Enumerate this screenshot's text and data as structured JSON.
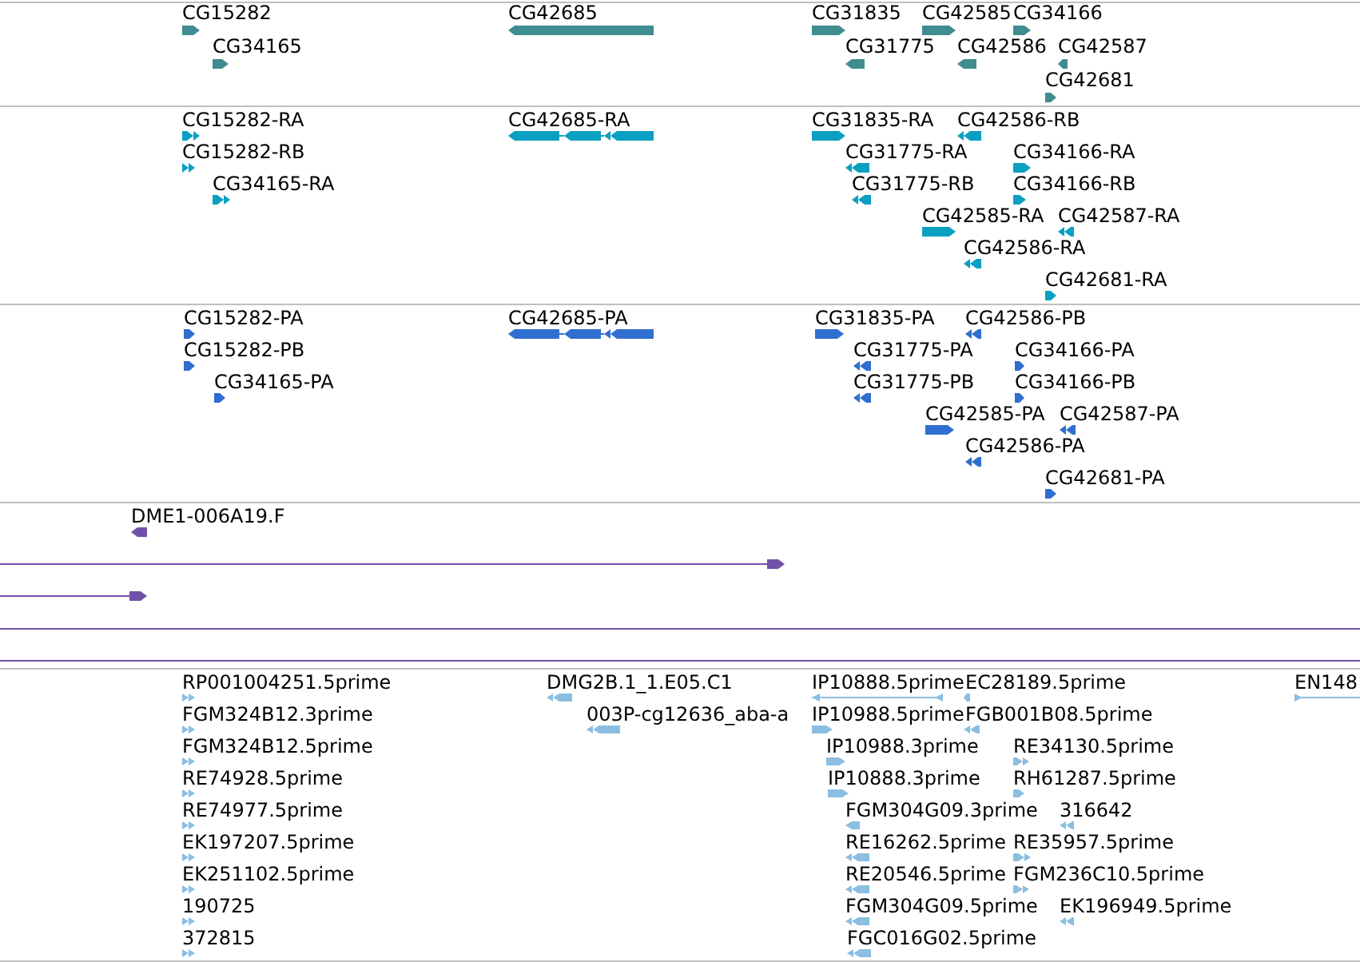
{
  "tracks": [
    {
      "color": "#3f8c91",
      "features": [
        {
          "label": "CG15282",
          "reverse": false
        },
        {
          "label": "CG42685",
          "reverse": true
        },
        {
          "label": "CG31835",
          "reverse": false
        },
        {
          "label": "CG42585",
          "reverse": false
        },
        {
          "label": "CG34166",
          "reverse": false
        },
        {
          "label": "CG34165",
          "reverse": false
        },
        {
          "label": "CG31775",
          "reverse": true
        },
        {
          "label": "CG42586",
          "reverse": true
        },
        {
          "label": "CG42587",
          "reverse": true
        },
        {
          "label": "CG42681",
          "reverse": false
        }
      ]
    },
    {
      "color": "#0aa0c2",
      "features": [
        {
          "label": "CG15282-RA",
          "reverse": false
        },
        {
          "label": "CG42685-RA",
          "reverse": true
        },
        {
          "label": "CG31835-RA",
          "reverse": false
        },
        {
          "label": "CG42586-RB",
          "reverse": true
        },
        {
          "label": "CG15282-RB",
          "reverse": false
        },
        {
          "label": "CG31775-RA",
          "reverse": true
        },
        {
          "label": "CG34166-RA",
          "reverse": false
        },
        {
          "label": "CG34165-RA",
          "reverse": false
        },
        {
          "label": "CG31775-RB",
          "reverse": true
        },
        {
          "label": "CG34166-RB",
          "reverse": false
        },
        {
          "label": "CG42585-RA",
          "reverse": false
        },
        {
          "label": "CG42587-RA",
          "reverse": true
        },
        {
          "label": "CG42586-RA",
          "reverse": true
        },
        {
          "label": "CG42681-RA",
          "reverse": false
        }
      ]
    },
    {
      "color": "#2f6fd0",
      "features": [
        {
          "label": "CG15282-PA",
          "reverse": false
        },
        {
          "label": "CG42685-PA",
          "reverse": true
        },
        {
          "label": "CG31835-PA",
          "reverse": false
        },
        {
          "label": "CG42586-PB",
          "reverse": true
        },
        {
          "label": "CG15282-PB",
          "reverse": false
        },
        {
          "label": "CG31775-PA",
          "reverse": true
        },
        {
          "label": "CG34166-PA",
          "reverse": false
        },
        {
          "label": "CG34165-PA",
          "reverse": false
        },
        {
          "label": "CG31775-PB",
          "reverse": true
        },
        {
          "label": "CG34166-PB",
          "reverse": false
        },
        {
          "label": "CG42585-PA",
          "reverse": false
        },
        {
          "label": "CG42587-PA",
          "reverse": true
        },
        {
          "label": "CG42586-PA",
          "reverse": true
        },
        {
          "label": "CG42681-PA",
          "reverse": false
        }
      ]
    },
    {
      "color": "#7052a8",
      "features": [
        {
          "label": "DME1-006A19.F",
          "reverse": true
        },
        {
          "reverse": false
        },
        {
          "reverse": false
        }
      ]
    },
    {
      "color": "#8bbee0",
      "features": [
        {
          "label": "RP001004251.5prime",
          "reverse": false
        },
        {
          "label": "DMG2B.1_1.E05.C1",
          "reverse": true
        },
        {
          "label": "IP10888.5prime",
          "reverse": true
        },
        {
          "label": "EC28189.5prime",
          "reverse": true
        },
        {
          "label": "EN148",
          "reverse": false
        },
        {
          "label": "FGM324B12.3prime",
          "reverse": false
        },
        {
          "label": "003P-cg12636_aba-a",
          "reverse": true
        },
        {
          "label": "IP10988.5prime",
          "reverse": false
        },
        {
          "label": "FGB001B08.5prime",
          "reverse": true
        },
        {
          "label": "FGM324B12.5prime",
          "reverse": false
        },
        {
          "label": "IP10988.3prime",
          "reverse": false
        },
        {
          "label": "RE34130.5prime",
          "reverse": false
        },
        {
          "label": "RE74928.5prime",
          "reverse": false
        },
        {
          "label": "IP10888.3prime",
          "reverse": false
        },
        {
          "label": "RH61287.5prime",
          "reverse": false
        },
        {
          "label": "RE74977.5prime",
          "reverse": false
        },
        {
          "label": "FGM304G09.3prime",
          "reverse": true
        },
        {
          "label": "316642",
          "reverse": true
        },
        {
          "label": "EK197207.5prime",
          "reverse": false
        },
        {
          "label": "RE16262.5prime",
          "reverse": true
        },
        {
          "label": "RE35957.5prime",
          "reverse": false
        },
        {
          "label": "EK251102.5prime",
          "reverse": false
        },
        {
          "label": "RE20546.5prime",
          "reverse": true
        },
        {
          "label": "FGM236C10.5prime",
          "reverse": false
        },
        {
          "label": "190725",
          "reverse": false
        },
        {
          "label": "FGM304G09.5prime",
          "reverse": true
        },
        {
          "label": "EK196949.5prime",
          "reverse": true
        },
        {
          "label": "372815",
          "reverse": false
        },
        {
          "label": "FGC016G02.5prime",
          "reverse": true
        }
      ]
    }
  ]
}
